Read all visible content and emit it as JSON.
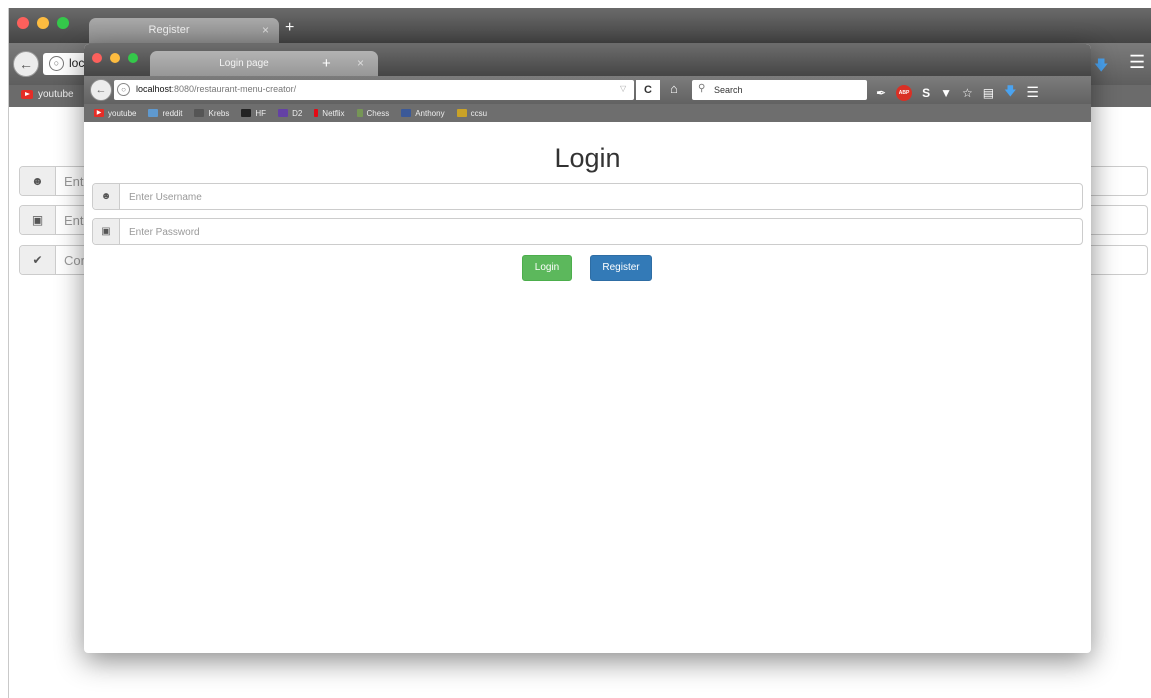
{
  "back_window": {
    "tab_title": "Register",
    "tab_close": "×",
    "new_tab": "+",
    "url_partial": "loc",
    "bookmark_youtube": "youtube",
    "username_partial": "Ente",
    "password_partial": "Ente",
    "confirm_partial": "Cor"
  },
  "front_window": {
    "tab_title": "Login page",
    "tab_close": "×",
    "new_tab": "+",
    "url_host": "localhost",
    "url_rest": ":8080/restaurant-menu-creator/",
    "search_placeholder": "Search",
    "bookmarks": [
      {
        "label": "youtube",
        "color": "#e52d27"
      },
      {
        "label": "reddit",
        "color": "#5f99cf"
      },
      {
        "label": "Krebs",
        "color": "#555555"
      },
      {
        "label": "HF",
        "color": "#333333"
      },
      {
        "label": "D2",
        "color": "#6441a5"
      },
      {
        "label": "Netflix",
        "color": "#e50914"
      },
      {
        "label": "Chess",
        "color": "#769656"
      },
      {
        "label": "Anthony",
        "color": "#3b5998"
      },
      {
        "label": "ccsu",
        "color": "#c9a227"
      }
    ]
  },
  "page": {
    "title": "Login",
    "username_placeholder": "Enter Username",
    "password_placeholder": "Enter Password",
    "login_label": "Login",
    "register_label": "Register"
  },
  "colors": {
    "login_button": "#5cb85c",
    "register_button": "#337ab7"
  }
}
